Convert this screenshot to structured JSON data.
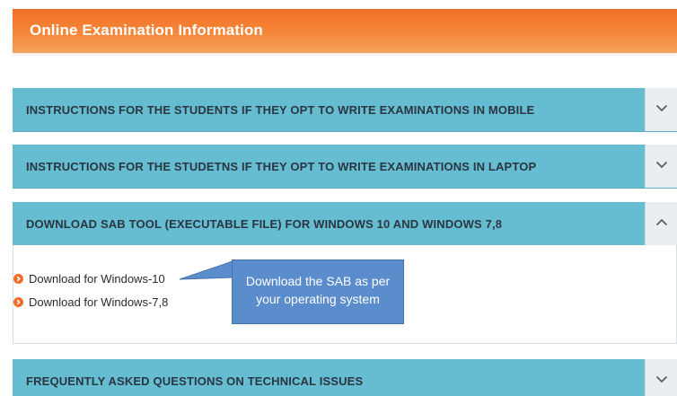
{
  "header": {
    "title": "Online Examination Information"
  },
  "accordion": [
    {
      "label": "INSTRUCTIONS FOR THE STUDENTS IF THEY OPT TO WRITE EXAMINATIONS IN MOBILE",
      "expanded": false,
      "icon": "chevron-down-icon"
    },
    {
      "label": "INSTRUCTIONS FOR THE STUDETNS IF THEY OPT TO WRITE EXAMINATIONS IN LAPTOP",
      "expanded": false,
      "icon": "chevron-down-icon"
    },
    {
      "label": "DOWNLOAD SAB TOOL (EXECUTABLE FILE) FOR WINDOWS 10 AND WINDOWS 7,8",
      "expanded": true,
      "icon": "chevron-up-icon",
      "items": [
        {
          "label": "Download for Windows-10"
        },
        {
          "label": "Download for Windows-7,8"
        }
      ]
    },
    {
      "label": "FREQUENTLY ASKED QUESTIONS ON TECHNICAL ISSUES",
      "expanded": false,
      "icon": "chevron-down-icon"
    }
  ],
  "callout": {
    "text": "Download the SAB as per your operating system"
  },
  "colors": {
    "header_orange": "#f26e26",
    "accordion_blue": "#66bcd1",
    "bullet_orange": "#f26e26",
    "callout_blue": "#5b8ccc"
  }
}
